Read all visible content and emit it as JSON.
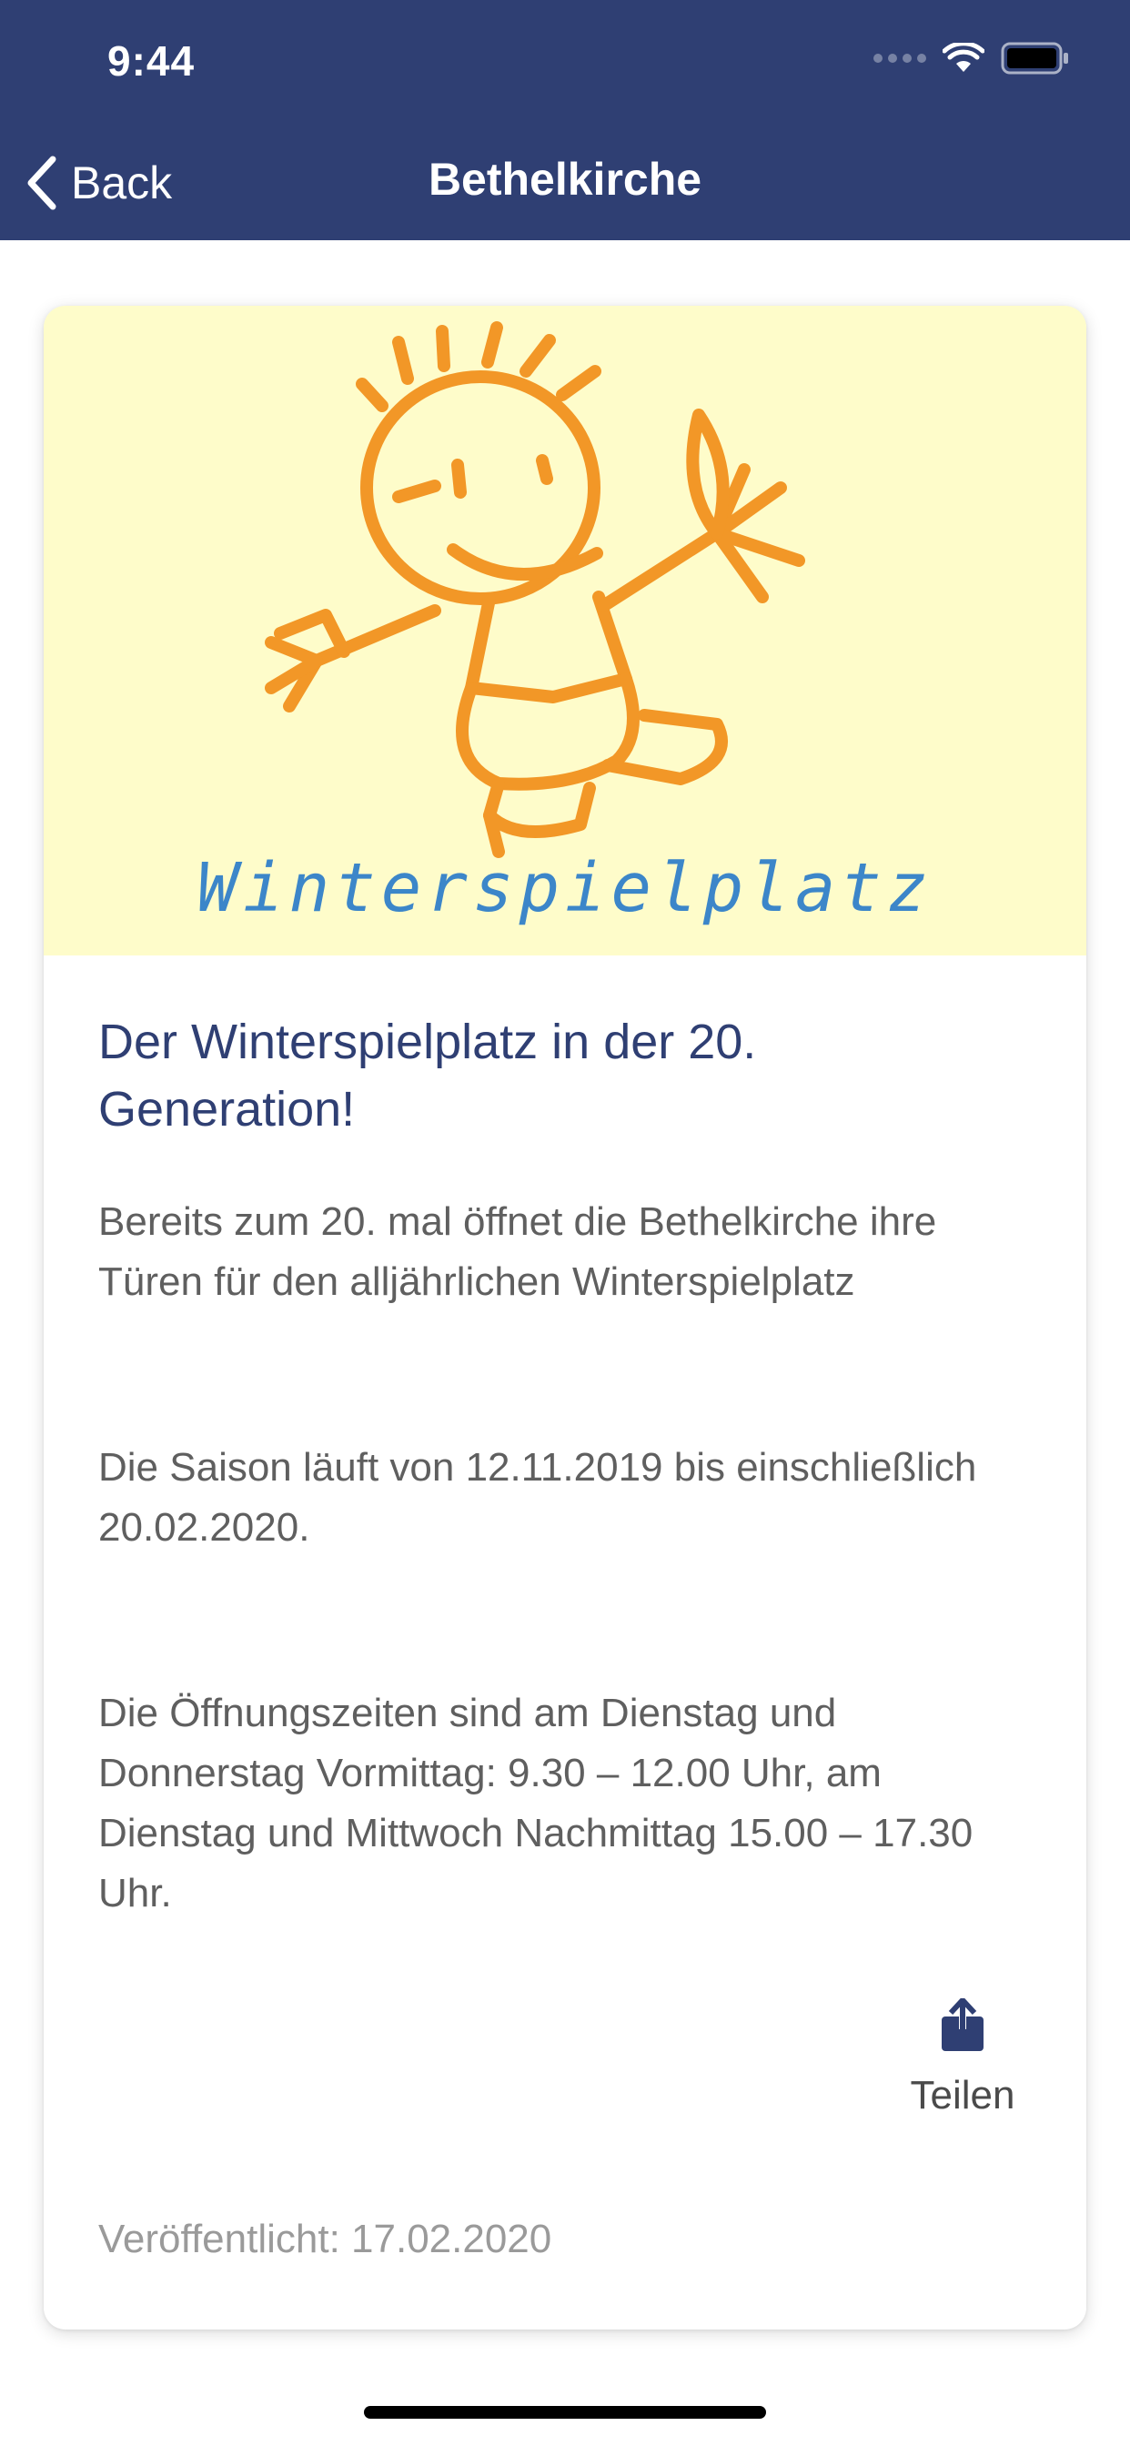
{
  "status_bar": {
    "time": "9:44"
  },
  "nav": {
    "back_label": "Back",
    "title": "Bethelkirche"
  },
  "article": {
    "hero_image_text": "Winterspielplatz",
    "title": "Der Winterspielplatz in der 20. Generation!",
    "paragraphs": [
      "Bereits zum 20. mal öffnet die Bethelkirche ihre Türen für den alljährlichen Winterspielplatz",
      "Die Saison läuft von 12.11.2019 bis einschließlich 20.02.2020.",
      "Die Öffnungszeiten sind am Dienstag und Donnerstag Vormittag: 9.30 – 12.00 Uhr, am Dienstag und Mittwoch Nachmittag 15.00 – 17.30 Uhr."
    ],
    "share_label": "Teilen",
    "published": "Veröffentlicht: 17.02.2020"
  },
  "icons": {
    "back": "chevron-left-icon",
    "share": "share-icon",
    "wifi": "wifi-icon",
    "battery": "battery-icon",
    "signal": "cellular-signal-icon"
  },
  "colors": {
    "header_bg": "#2f3f73",
    "title_text": "#2f3f73",
    "hero_bg": "#fefcca",
    "logo_orange": "#f29727",
    "logo_blue": "#3c86c9"
  }
}
